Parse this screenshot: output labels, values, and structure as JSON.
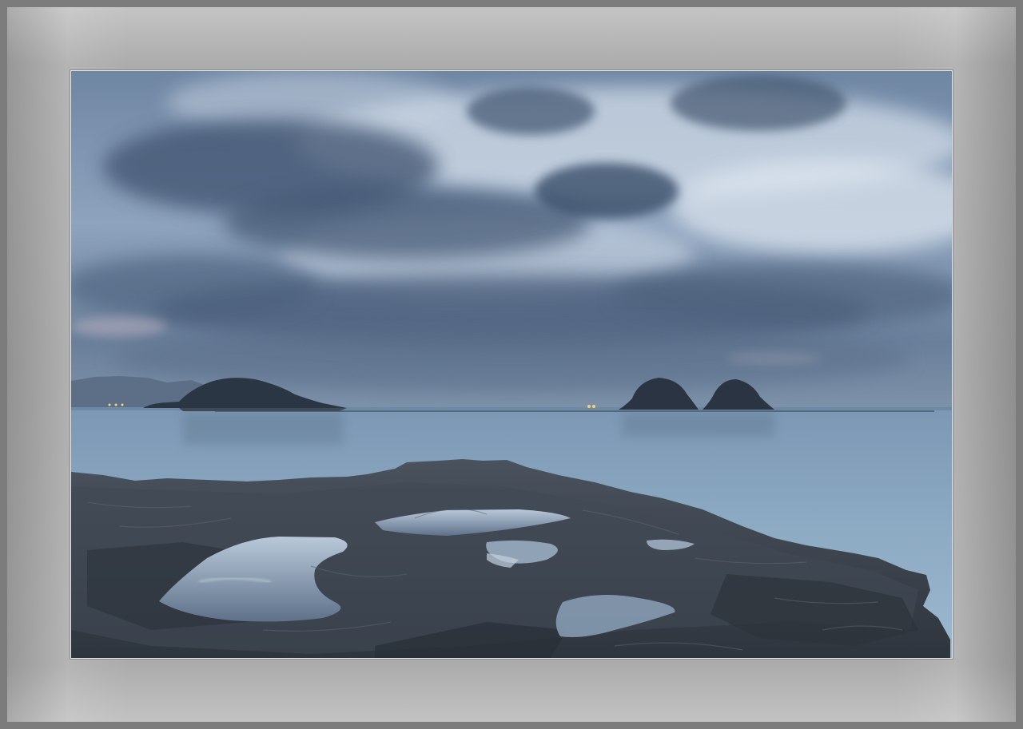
{
  "image": {
    "subject": "coastal-seascape-at-dusk",
    "elements": [
      "cloudy-sky",
      "calm-sea",
      "islands",
      "rocky-shore",
      "tide-pools"
    ]
  },
  "colors": {
    "frame_outer": "#7c7c7c",
    "mat": "#a8a8a8",
    "sky_light": "#c9d5e3",
    "sky_dark": "#4f6580",
    "sea": "#8aa6bf",
    "rock": "#3a414b"
  }
}
